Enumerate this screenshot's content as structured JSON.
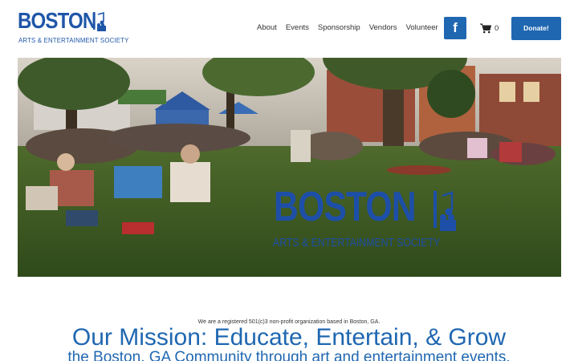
{
  "brand": {
    "name_big": "BOSTON",
    "name_small": "ARTS & ENTERTAINMENT SOCIETY",
    "color": "#1f56a8"
  },
  "nav": {
    "items": [
      {
        "label": "About"
      },
      {
        "label": "Events"
      },
      {
        "label": "Sponsorship"
      },
      {
        "label": "Vendors"
      },
      {
        "label": "Volunteer"
      }
    ]
  },
  "social": {
    "facebook_glyph": "f",
    "icon": "facebook-icon"
  },
  "cart": {
    "icon": "shopping-cart-icon",
    "count": "0"
  },
  "donate": {
    "label": "Donate!",
    "color": "#1f67b1"
  },
  "hero": {
    "overlay_big": "BOSTON",
    "overlay_small": "ARTS & ENTERTAINMENT SOCIETY",
    "overlay_mark_icon": "paintbrush-music-camera-icon"
  },
  "content": {
    "intro": "We are a registered 501(c)3 non-profit organization based in Boston, GA.",
    "mission_title": "Our Mission: Educate, Entertain, & Grow",
    "mission_sub": "the Boston, GA Community through art and entertainment events."
  }
}
